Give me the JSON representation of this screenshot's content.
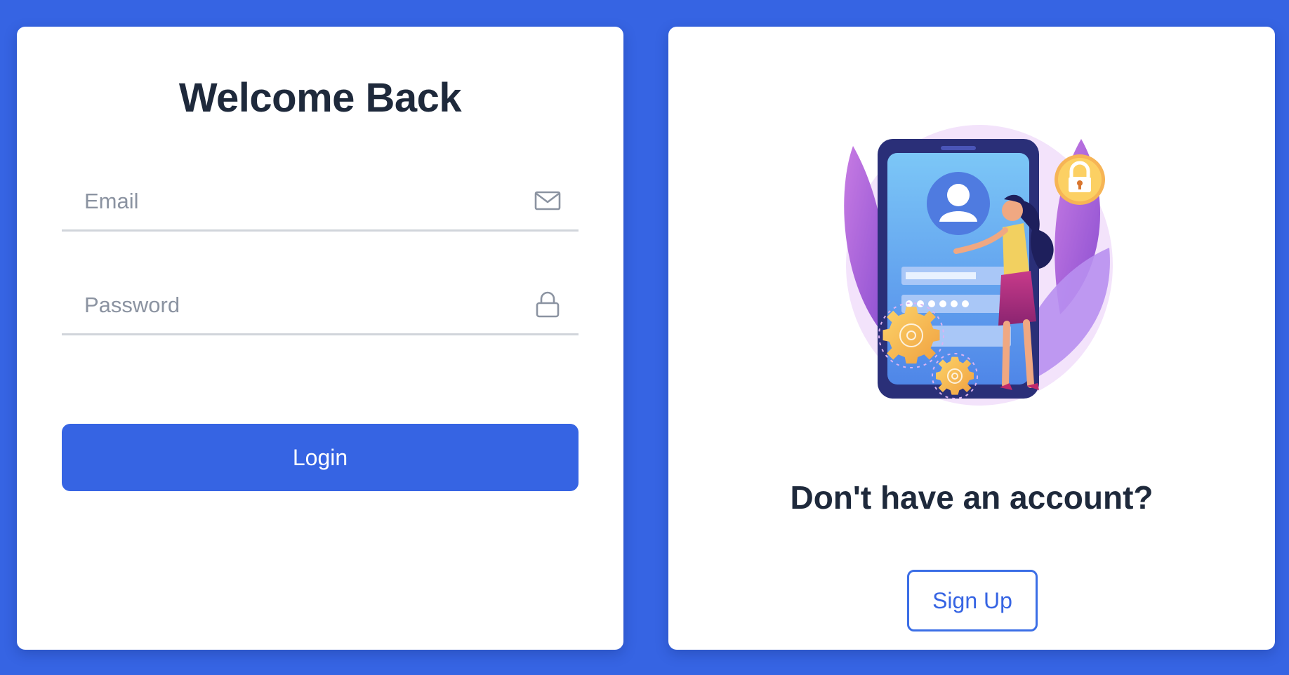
{
  "colors": {
    "background": "#3664e3",
    "card": "#ffffff",
    "primary": "#3664e3",
    "heading": "#1e293b",
    "placeholder": "#8b93a1",
    "divider": "#d1d5db"
  },
  "login": {
    "title": "Welcome Back",
    "email": {
      "value": "",
      "placeholder": "Email",
      "icon": "envelope-icon"
    },
    "password": {
      "value": "",
      "placeholder": "Password",
      "icon": "lock-icon"
    },
    "submit_label": "Login"
  },
  "signup": {
    "illustration": "phone-login-illustration",
    "heading": "Don't have an account?",
    "button_label": "Sign Up"
  }
}
